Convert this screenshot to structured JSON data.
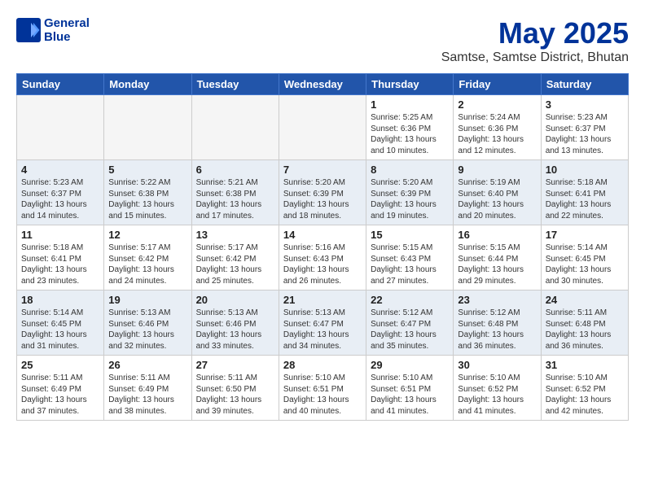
{
  "header": {
    "logo_line1": "General",
    "logo_line2": "Blue",
    "main_title": "May 2025",
    "subtitle": "Samtse, Samtse District, Bhutan"
  },
  "days_of_week": [
    "Sunday",
    "Monday",
    "Tuesday",
    "Wednesday",
    "Thursday",
    "Friday",
    "Saturday"
  ],
  "weeks": [
    [
      {
        "num": "",
        "info": ""
      },
      {
        "num": "",
        "info": ""
      },
      {
        "num": "",
        "info": ""
      },
      {
        "num": "",
        "info": ""
      },
      {
        "num": "1",
        "info": "Sunrise: 5:25 AM\nSunset: 6:36 PM\nDaylight: 13 hours\nand 10 minutes."
      },
      {
        "num": "2",
        "info": "Sunrise: 5:24 AM\nSunset: 6:36 PM\nDaylight: 13 hours\nand 12 minutes."
      },
      {
        "num": "3",
        "info": "Sunrise: 5:23 AM\nSunset: 6:37 PM\nDaylight: 13 hours\nand 13 minutes."
      }
    ],
    [
      {
        "num": "4",
        "info": "Sunrise: 5:23 AM\nSunset: 6:37 PM\nDaylight: 13 hours\nand 14 minutes."
      },
      {
        "num": "5",
        "info": "Sunrise: 5:22 AM\nSunset: 6:38 PM\nDaylight: 13 hours\nand 15 minutes."
      },
      {
        "num": "6",
        "info": "Sunrise: 5:21 AM\nSunset: 6:38 PM\nDaylight: 13 hours\nand 17 minutes."
      },
      {
        "num": "7",
        "info": "Sunrise: 5:20 AM\nSunset: 6:39 PM\nDaylight: 13 hours\nand 18 minutes."
      },
      {
        "num": "8",
        "info": "Sunrise: 5:20 AM\nSunset: 6:39 PM\nDaylight: 13 hours\nand 19 minutes."
      },
      {
        "num": "9",
        "info": "Sunrise: 5:19 AM\nSunset: 6:40 PM\nDaylight: 13 hours\nand 20 minutes."
      },
      {
        "num": "10",
        "info": "Sunrise: 5:18 AM\nSunset: 6:41 PM\nDaylight: 13 hours\nand 22 minutes."
      }
    ],
    [
      {
        "num": "11",
        "info": "Sunrise: 5:18 AM\nSunset: 6:41 PM\nDaylight: 13 hours\nand 23 minutes."
      },
      {
        "num": "12",
        "info": "Sunrise: 5:17 AM\nSunset: 6:42 PM\nDaylight: 13 hours\nand 24 minutes."
      },
      {
        "num": "13",
        "info": "Sunrise: 5:17 AM\nSunset: 6:42 PM\nDaylight: 13 hours\nand 25 minutes."
      },
      {
        "num": "14",
        "info": "Sunrise: 5:16 AM\nSunset: 6:43 PM\nDaylight: 13 hours\nand 26 minutes."
      },
      {
        "num": "15",
        "info": "Sunrise: 5:15 AM\nSunset: 6:43 PM\nDaylight: 13 hours\nand 27 minutes."
      },
      {
        "num": "16",
        "info": "Sunrise: 5:15 AM\nSunset: 6:44 PM\nDaylight: 13 hours\nand 29 minutes."
      },
      {
        "num": "17",
        "info": "Sunrise: 5:14 AM\nSunset: 6:45 PM\nDaylight: 13 hours\nand 30 minutes."
      }
    ],
    [
      {
        "num": "18",
        "info": "Sunrise: 5:14 AM\nSunset: 6:45 PM\nDaylight: 13 hours\nand 31 minutes."
      },
      {
        "num": "19",
        "info": "Sunrise: 5:13 AM\nSunset: 6:46 PM\nDaylight: 13 hours\nand 32 minutes."
      },
      {
        "num": "20",
        "info": "Sunrise: 5:13 AM\nSunset: 6:46 PM\nDaylight: 13 hours\nand 33 minutes."
      },
      {
        "num": "21",
        "info": "Sunrise: 5:13 AM\nSunset: 6:47 PM\nDaylight: 13 hours\nand 34 minutes."
      },
      {
        "num": "22",
        "info": "Sunrise: 5:12 AM\nSunset: 6:47 PM\nDaylight: 13 hours\nand 35 minutes."
      },
      {
        "num": "23",
        "info": "Sunrise: 5:12 AM\nSunset: 6:48 PM\nDaylight: 13 hours\nand 36 minutes."
      },
      {
        "num": "24",
        "info": "Sunrise: 5:11 AM\nSunset: 6:48 PM\nDaylight: 13 hours\nand 36 minutes."
      }
    ],
    [
      {
        "num": "25",
        "info": "Sunrise: 5:11 AM\nSunset: 6:49 PM\nDaylight: 13 hours\nand 37 minutes."
      },
      {
        "num": "26",
        "info": "Sunrise: 5:11 AM\nSunset: 6:49 PM\nDaylight: 13 hours\nand 38 minutes."
      },
      {
        "num": "27",
        "info": "Sunrise: 5:11 AM\nSunset: 6:50 PM\nDaylight: 13 hours\nand 39 minutes."
      },
      {
        "num": "28",
        "info": "Sunrise: 5:10 AM\nSunset: 6:51 PM\nDaylight: 13 hours\nand 40 minutes."
      },
      {
        "num": "29",
        "info": "Sunrise: 5:10 AM\nSunset: 6:51 PM\nDaylight: 13 hours\nand 41 minutes."
      },
      {
        "num": "30",
        "info": "Sunrise: 5:10 AM\nSunset: 6:52 PM\nDaylight: 13 hours\nand 41 minutes."
      },
      {
        "num": "31",
        "info": "Sunrise: 5:10 AM\nSunset: 6:52 PM\nDaylight: 13 hours\nand 42 minutes."
      }
    ]
  ]
}
